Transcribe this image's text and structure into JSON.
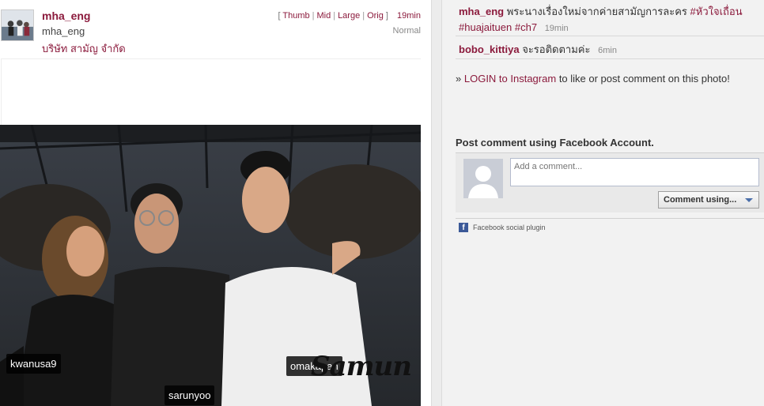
{
  "post": {
    "username": "mha_eng",
    "full_name": "mha_eng",
    "company": "บริษัท สามัญ จำกัด",
    "size_links": [
      "Thumb",
      "Mid",
      "Large",
      "Orig"
    ],
    "time_ago": "19min",
    "filter": "Normal",
    "photo_tags": [
      "kwanusa9",
      "sarunyoo",
      "omakapan"
    ],
    "watermark": "Samun"
  },
  "comments": [
    {
      "username": "mha_eng",
      "text": "พระนางเรื่องใหม่จากค่ายสามัญการละคร",
      "hashtags": [
        "#หัวใจเถื่อน",
        "#huajaituen",
        "#ch7"
      ],
      "time_ago": "19min"
    },
    {
      "username": "bobo_kittiya",
      "text": "จะรอติดตามค่ะ",
      "time_ago": "6min"
    }
  ],
  "login_prompt": {
    "prefix": "»",
    "link": "LOGIN to Instagram",
    "suffix": "to like or post comment on this photo!"
  },
  "facebook": {
    "title": "Post comment using Facebook Account.",
    "placeholder": "Add a comment...",
    "button": "Comment using...",
    "plugin_label": "Facebook social plugin",
    "logo_letter": "f",
    "brand_color": "#3b5998"
  },
  "colors": {
    "accent": "#8b1a3c",
    "sidebar_bg": "#f2f2f2"
  }
}
